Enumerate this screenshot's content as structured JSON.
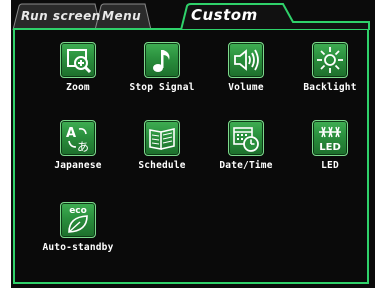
{
  "tabs": [
    {
      "label": "Run screen",
      "active": false
    },
    {
      "label": "Menu",
      "active": false
    },
    {
      "label": "Custom",
      "active": true
    }
  ],
  "apps": [
    {
      "label": "Zoom",
      "icon": "zoom-magnifier-icon"
    },
    {
      "label": "Stop Signal",
      "icon": "music-note-icon"
    },
    {
      "label": "Volume",
      "icon": "speaker-icon"
    },
    {
      "label": "Backlight",
      "icon": "sun-icon"
    },
    {
      "label": "Japanese",
      "icon": "language-a-icon"
    },
    {
      "label": "Schedule",
      "icon": "notebook-icon"
    },
    {
      "label": "Date/Time",
      "icon": "calendar-clock-icon"
    },
    {
      "label": "LED",
      "icon": "led-icon"
    },
    {
      "label": "Auto-standby",
      "icon": "eco-leaf-icon"
    }
  ],
  "icon_text": {
    "led": "LED",
    "eco": "eco",
    "a_letter": "A",
    "ja_char": "あ"
  },
  "colors": {
    "accent": "#2fd16a",
    "icon_bg": "#2a8f3d",
    "background": "#0a0a0a"
  }
}
